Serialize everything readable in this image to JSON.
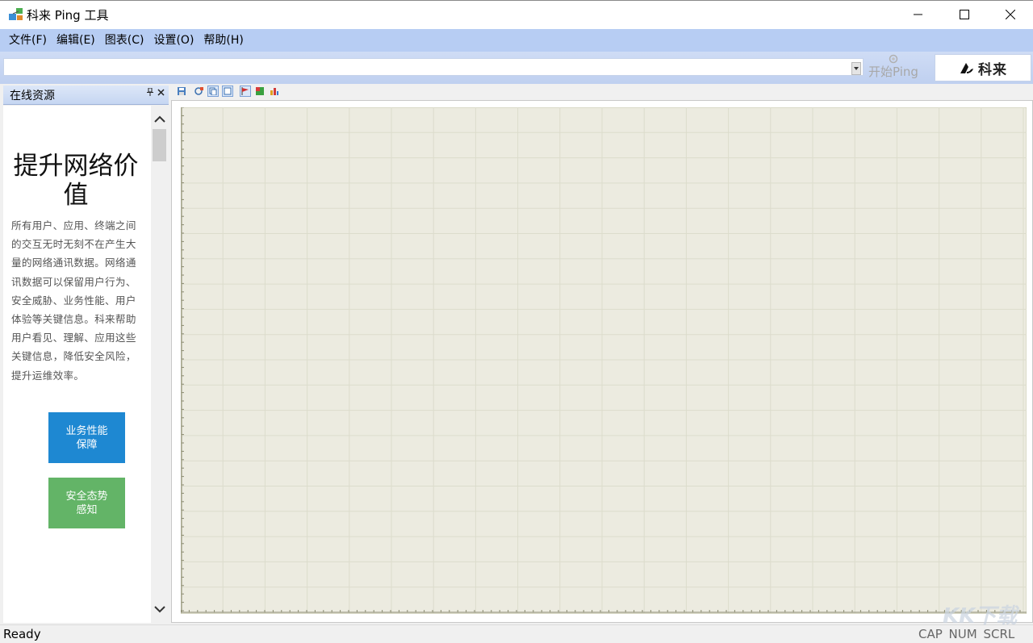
{
  "window": {
    "title": "科来 Ping 工具",
    "icon": "network-app-icon"
  },
  "menu": {
    "items": [
      {
        "label": "文件(F)"
      },
      {
        "label": "编辑(E)"
      },
      {
        "label": "图表(C)"
      },
      {
        "label": "设置(O)"
      },
      {
        "label": "帮助(H)"
      }
    ]
  },
  "toolbar": {
    "host_value": "",
    "start_ping_label": "开始Ping",
    "logo_text": "科来"
  },
  "left_panel": {
    "title": "在线资源",
    "headline": "提升网络价值",
    "body": "所有用户、应用、终端之间的交互无时无刻不在产生大量的网络通讯数据。网络通讯数据可以保留用户行为、安全威胁、业务性能、用户体验等关键信息。科来帮助用户看见、理解、应用这些关键信息，降低安全风险，提升运维效率。",
    "buttons": [
      {
        "line1": "业务性能",
        "line2": "保障",
        "color": "#1e88d2"
      },
      {
        "line1": "安全态势",
        "line2": "感知",
        "color": "#63b467"
      }
    ]
  },
  "chart_toolbar": {
    "icons": [
      "save-icon",
      "options-icon",
      "copy-icon",
      "layout-icon",
      "flag-chart-icon",
      "color-icon",
      "bar-chart-icon"
    ]
  },
  "chart_data": {
    "type": "line",
    "series": [],
    "grid": true,
    "background": "#ecebe0"
  },
  "status": {
    "text": "Ready",
    "indicators": "CAP  NUM  SCRL"
  },
  "watermark": "KK下载",
  "colors": {
    "menu_bg": "#b7cdf3",
    "chart_bg": "#ecebe0",
    "grid_line": "#dcdccc"
  }
}
